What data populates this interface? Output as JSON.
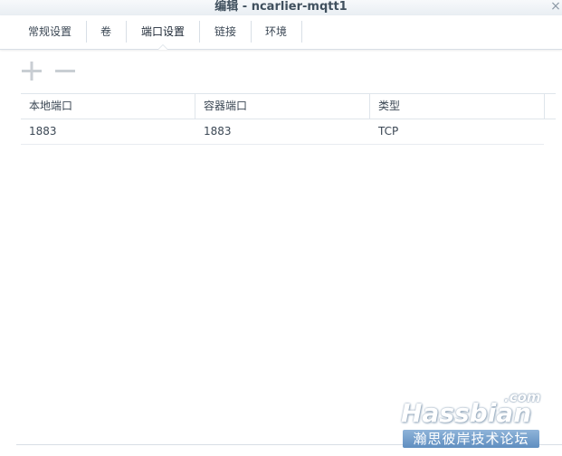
{
  "window": {
    "title": "编辑 - ncarlier-mqtt1",
    "close_glyph": "×"
  },
  "tabs": [
    {
      "label": "常规设置",
      "active": false
    },
    {
      "label": "卷",
      "active": false
    },
    {
      "label": "端口设置",
      "active": true
    },
    {
      "label": "链接",
      "active": false
    },
    {
      "label": "环境",
      "active": false
    }
  ],
  "toolbar": {
    "add_icon": "plus-icon",
    "remove_icon": "minus-icon",
    "icon_color": "#c9ced3"
  },
  "grid": {
    "columns": [
      "本地端口",
      "容器端口",
      "类型"
    ],
    "rows": [
      [
        "1883",
        "1883",
        "TCP"
      ]
    ]
  },
  "watermark": {
    "brand": "Hassbian",
    "suffix": ".com",
    "subtitle": "瀚思彼岸技术论坛"
  }
}
